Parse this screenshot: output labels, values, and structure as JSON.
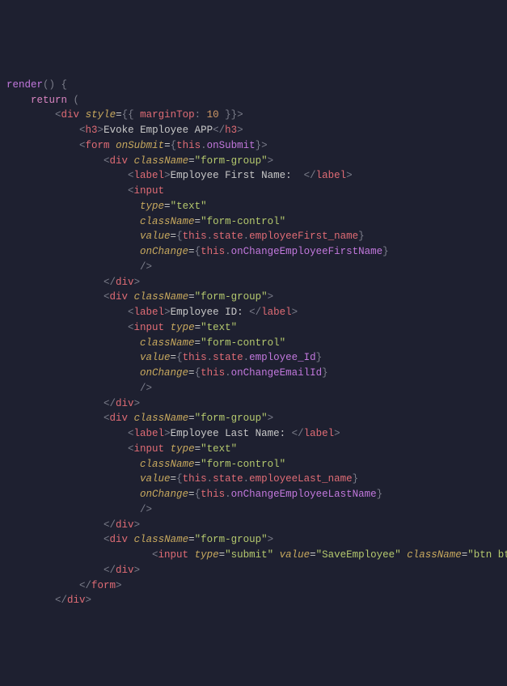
{
  "code": {
    "l01_render": "render",
    "l02_return": "return",
    "l03_marginTop": "marginTop",
    "l03_ten": "10",
    "l04_h3_text": "Evoke Employee APP",
    "l05_onSubmit": "onSubmit",
    "l05_this": "this",
    "l05_method": "onSubmit",
    "l06_className": "className",
    "l06_formgroup": "\"form-group\"",
    "l07_label_text": "Employee First Name:  ",
    "l09_type_text": "\"text\"",
    "l10_formcontrol": "\"form-control\"",
    "l11_state": "state",
    "l11_field": "employeeFirst_name",
    "l12_onChange": "onChange",
    "l12_handler": "onChangeEmployeeFirstName",
    "l17_label_text": "Employee ID: ",
    "l20_field": "employee_Id",
    "l21_handler": "onChangeEmailId",
    "l26_label_text": "Employee Last Name: ",
    "l29_field": "employeeLast_name",
    "l30_handler": "onChangeEmployeeLastName",
    "l35_submit": "\"submit\"",
    "l35_value": "\"SaveEmployee\"",
    "l35_btn": "\"btn btn-primary\"",
    "tag_div": "div",
    "tag_h3": "h3",
    "tag_form": "form",
    "tag_label": "label",
    "tag_input": "input",
    "attr_style": "style",
    "attr_type": "type",
    "attr_value": "value",
    "kw_this": "this"
  }
}
